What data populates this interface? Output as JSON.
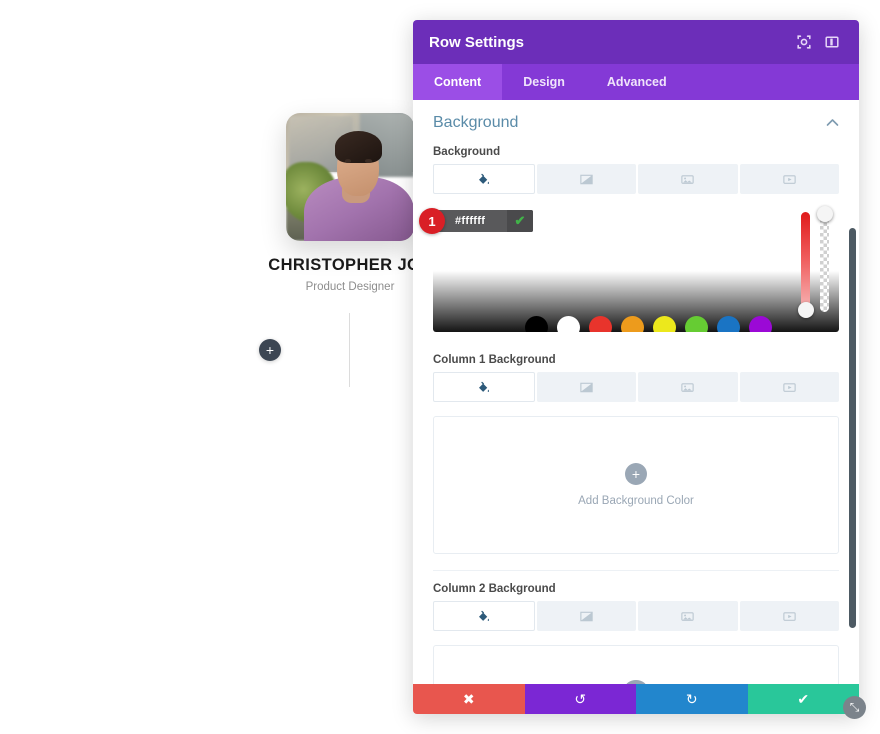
{
  "canvas": {
    "profile": {
      "name": "CHRISTOPHER JOE",
      "role": "Product Designer",
      "photo_alt": "profile-photo"
    },
    "add_module_label": "+"
  },
  "modal": {
    "title": "Row Settings",
    "header_icons": [
      {
        "name": "focus-icon",
        "glyph": "◎"
      },
      {
        "name": "layout-panel-icon",
        "glyph": "▤"
      }
    ],
    "tabs": [
      {
        "label": "Content",
        "active": true
      },
      {
        "label": "Design",
        "active": false
      },
      {
        "label": "Advanced",
        "active": false
      }
    ],
    "section": {
      "title": "Background",
      "collapse_glyph": "⌃"
    },
    "background": {
      "label": "Background",
      "type_tabs": [
        {
          "name": "background-color-tab",
          "label": "Color",
          "active": true
        },
        {
          "name": "background-gradient-tab",
          "label": "Gradient",
          "active": false
        },
        {
          "name": "background-image-tab",
          "label": "Image",
          "active": false
        },
        {
          "name": "background-video-tab",
          "label": "Video",
          "active": false
        }
      ],
      "picker": {
        "badge": "1",
        "hex_value": "#ffffff",
        "confirm_glyph": "✔",
        "swatches": [
          {
            "name": "swatch-black",
            "color": "#000000"
          },
          {
            "name": "swatch-white",
            "color": "#ffffff"
          },
          {
            "name": "swatch-red",
            "color": "#e8342c"
          },
          {
            "name": "swatch-orange",
            "color": "#ed9b1c"
          },
          {
            "name": "swatch-yellow",
            "color": "#ece81c"
          },
          {
            "name": "swatch-green",
            "color": "#66cc33"
          },
          {
            "name": "swatch-blue",
            "color": "#1a74c4"
          },
          {
            "name": "swatch-purple",
            "color": "#9b09d6"
          }
        ],
        "hue_slider_name": "hue-slider",
        "alpha_slider_name": "alpha-slider"
      }
    },
    "column1": {
      "label": "Column 1 Background",
      "type_tabs": [
        {
          "name": "col1-color-tab",
          "label": "Color",
          "active": true
        },
        {
          "name": "col1-gradient-tab",
          "label": "Gradient",
          "active": false
        },
        {
          "name": "col1-image-tab",
          "label": "Image",
          "active": false
        },
        {
          "name": "col1-video-tab",
          "label": "Video",
          "active": false
        }
      ],
      "add_label": "Add Background Color",
      "add_glyph": "+"
    },
    "column2": {
      "label": "Column 2 Background",
      "type_tabs": [
        {
          "name": "col2-color-tab",
          "label": "Color",
          "active": true
        },
        {
          "name": "col2-gradient-tab",
          "label": "Gradient",
          "active": false
        },
        {
          "name": "col2-image-tab",
          "label": "Image",
          "active": false
        },
        {
          "name": "col2-video-tab",
          "label": "Video",
          "active": false
        }
      ],
      "add_glyph": "+"
    },
    "footer": [
      {
        "name": "cancel-button",
        "glyph": "✖",
        "color": "#e8564e"
      },
      {
        "name": "undo-button",
        "glyph": "↺",
        "color": "#7b27d4"
      },
      {
        "name": "redo-button",
        "glyph": "↻",
        "color": "#2286cd"
      },
      {
        "name": "save-button",
        "glyph": "✔",
        "color": "#29c79a"
      }
    ],
    "resize_glyph": "⤡"
  },
  "colors": {
    "header_purple": "#6c2eb9",
    "tabbar_purple": "#8439d6",
    "active_tab_purple": "#9b4ee6",
    "section_title_blue": "#5a8ba8",
    "badge_red": "#d91f26"
  }
}
